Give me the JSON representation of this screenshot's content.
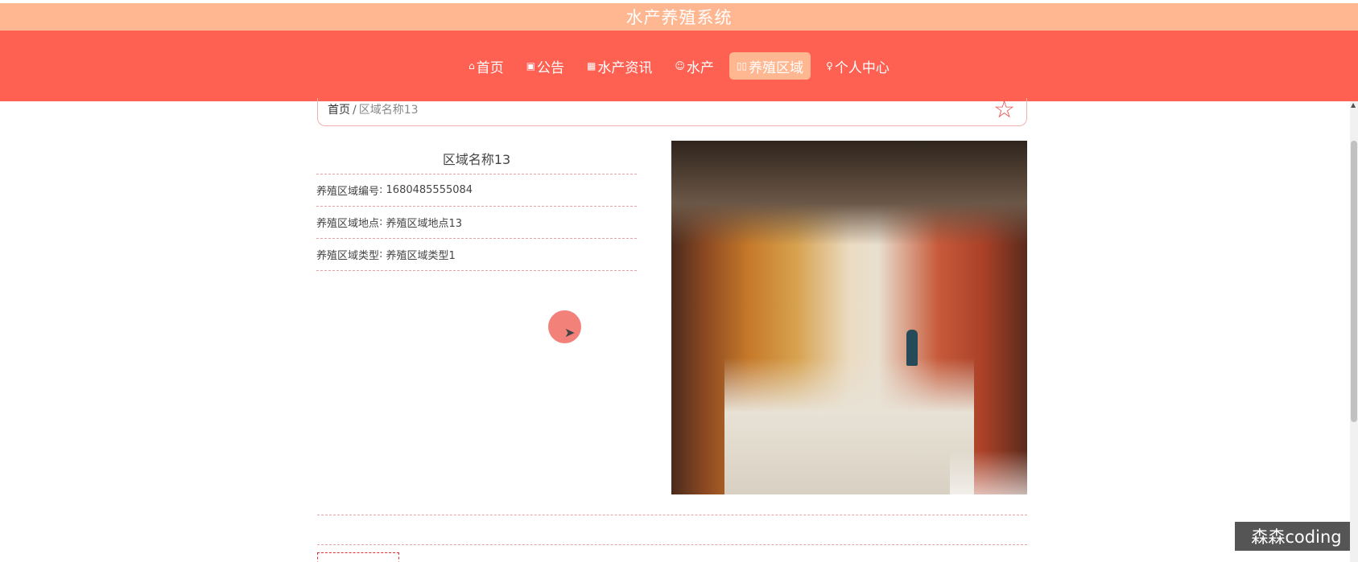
{
  "app_title": "水产养殖系统",
  "nav": {
    "items": [
      {
        "icon": "⌂",
        "label": "首页"
      },
      {
        "icon": "▣",
        "label": "公告"
      },
      {
        "icon": "▦",
        "label": "水产资讯"
      },
      {
        "icon": "☺",
        "label": "水产"
      },
      {
        "icon": "▯▯",
        "label": "养殖区域"
      },
      {
        "icon": "♀",
        "label": "个人中心"
      }
    ],
    "active_index": 4
  },
  "breadcrumb": {
    "home": "首页",
    "separator": "/",
    "current": "区域名称13"
  },
  "favorite_icon": "☆",
  "detail": {
    "title": "区域名称13",
    "rows": [
      {
        "label": "养殖区域编号",
        "value": "1680485555084"
      },
      {
        "label": "养殖区域地点",
        "value": "养殖区域地点13"
      },
      {
        "label": "养殖区域类型",
        "value": "养殖区域类型1"
      }
    ]
  },
  "watermark": "森森coding",
  "colors": {
    "nav_bg": "#fe6052",
    "title_bg": "#ffb791",
    "active_tab": "#ffb791",
    "accent_border": "#e7a3a3"
  }
}
